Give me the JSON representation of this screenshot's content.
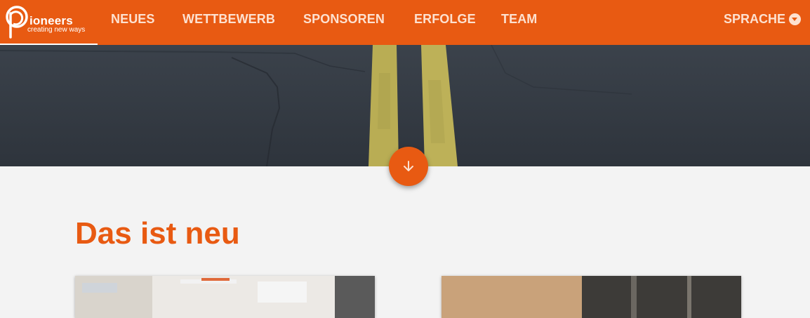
{
  "brand": {
    "name": "ioneers",
    "tagline": "creating new ways"
  },
  "nav": {
    "items": [
      {
        "label": "NEUES"
      },
      {
        "label": "WETTBEWERB"
      },
      {
        "label": "SPONSOREN"
      },
      {
        "label": "ERFOLGE"
      },
      {
        "label": "TEAM"
      }
    ],
    "language_label": "SPRACHE",
    "language_icon": "chevron-down-circle-icon"
  },
  "hero": {
    "image": "asphalt road with double yellow center line"
  },
  "scroll_button": {
    "icon": "arrow-down-icon"
  },
  "section": {
    "title": "Das ist neu"
  },
  "colors": {
    "brand_orange": "#e85a12",
    "nav_text": "#fde1d0",
    "page_background": "#f3f3f3"
  }
}
